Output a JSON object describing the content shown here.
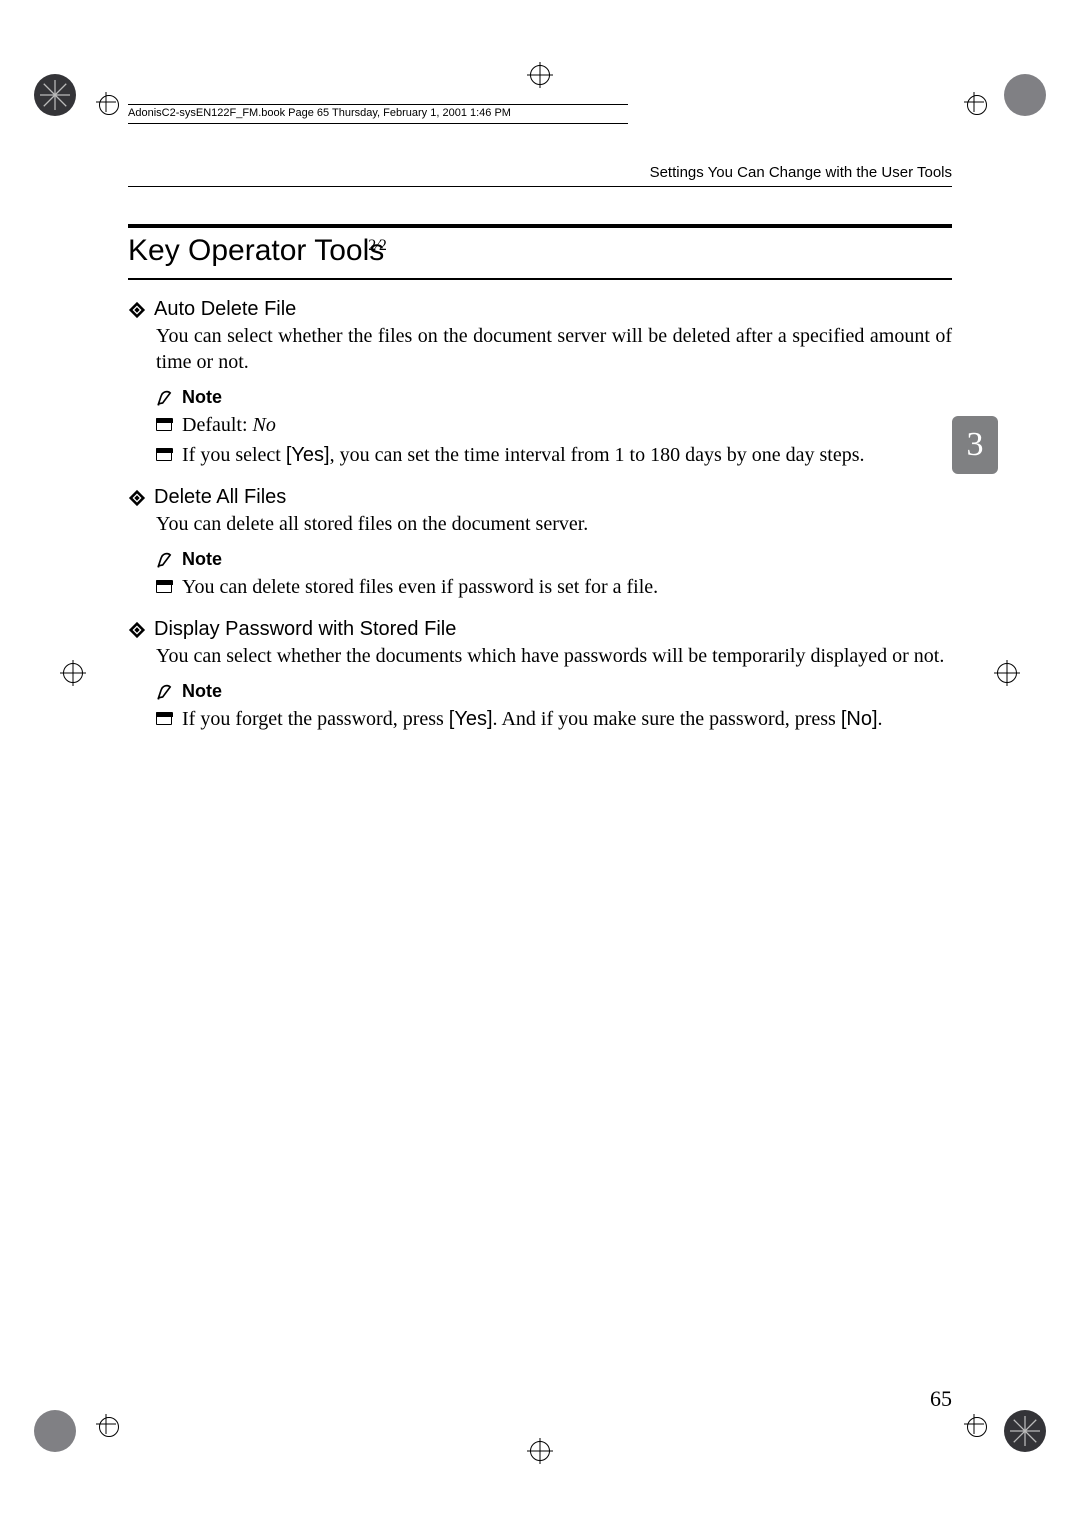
{
  "book_info": "AdonisC2-sysEN122F_FM.book  Page 65  Thursday, February 1, 2001  1:46 PM",
  "running_head": "Settings You Can Change with the User Tools",
  "section_title": "Key Operator Tools",
  "section_sup": "2⁄2",
  "items": [
    {
      "title": "Auto Delete File",
      "body": "You can select whether the files on the document server will be deleted after a specified amount of time or not.",
      "note_label": "Note",
      "bullets": [
        {
          "pre": "Default: ",
          "italic": "No",
          "post": ""
        },
        {
          "pre": "If you select ",
          "yes": "[Yes]",
          "post": ", you can set the time interval from 1 to 180 days by one day steps."
        }
      ]
    },
    {
      "title": "Delete All Files",
      "body": "You can delete all stored files on the document server.",
      "note_label": "Note",
      "bullets": [
        {
          "pre": "You can delete stored files even if password is set for a file.",
          "post": ""
        }
      ]
    },
    {
      "title": "Display Password with Stored File",
      "body": "You can select whether the documents which have passwords will be temporarily displayed or not.",
      "note_label": "Note",
      "bullets": [
        {
          "pre": "If you forget the password, press ",
          "yes": "[Yes]",
          "mid": ". And if you make sure the password, press ",
          "yes2": "[No]",
          "post": "."
        }
      ]
    }
  ],
  "chapter_tab": "3",
  "page_number": "65"
}
